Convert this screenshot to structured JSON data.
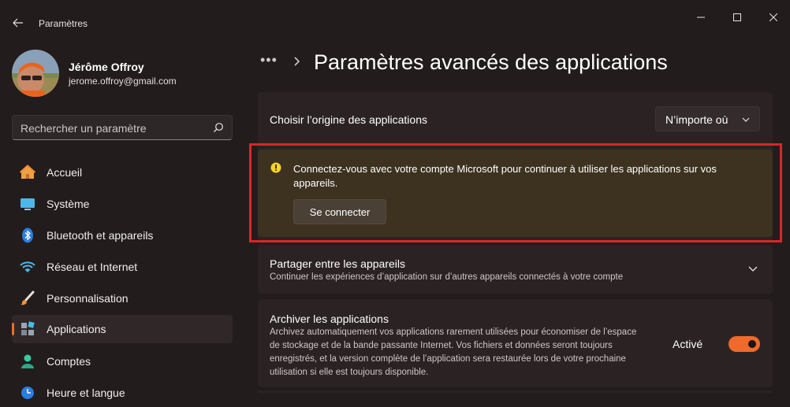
{
  "window": {
    "title": "Paramètres"
  },
  "profile": {
    "name": "Jérôme Offroy",
    "email": "jerome.offroy@gmail.com"
  },
  "search": {
    "placeholder": "Rechercher un paramètre"
  },
  "sidebar": {
    "items": [
      {
        "label": "Accueil",
        "icon": "home-icon"
      },
      {
        "label": "Système",
        "icon": "monitor-icon"
      },
      {
        "label": "Bluetooth et appareils",
        "icon": "bluetooth-icon"
      },
      {
        "label": "Réseau et Internet",
        "icon": "wifi-icon"
      },
      {
        "label": "Personnalisation",
        "icon": "paintbrush-icon"
      },
      {
        "label": "Applications",
        "icon": "apps-icon",
        "selected": true
      },
      {
        "label": "Comptes",
        "icon": "person-icon"
      },
      {
        "label": "Heure et langue",
        "icon": "clock-globe-icon"
      }
    ]
  },
  "header": {
    "breadcrumb_more": "•••",
    "title": "Paramètres avancés des applications"
  },
  "origin": {
    "label": "Choisir l’origine des applications",
    "selected": "N’importe où"
  },
  "warning": {
    "message": "Connectez-vous avec votre compte Microsoft pour continuer à utiliser les applications sur vos appareils.",
    "button": "Se connecter"
  },
  "share": {
    "title": "Partager entre les appareils",
    "description": "Continuer les expériences d’application sur d’autres appareils connectés à votre compte"
  },
  "archive": {
    "title": "Archiver les applications",
    "description": "Archivez automatiquement vos applications rarement utilisées pour économiser de l’espace de stockage et de la bande passante Internet. Vos fichiers et données seront toujours enregistrés, et la version complète de l’application sera restaurée lors de votre prochaine utilisation si elle est toujours disponible.",
    "state_label": "Activé",
    "enabled": true
  },
  "colors": {
    "accent": "#f06a2c",
    "highlight_border": "#d8262a",
    "warning_bg": "#3d3220"
  }
}
